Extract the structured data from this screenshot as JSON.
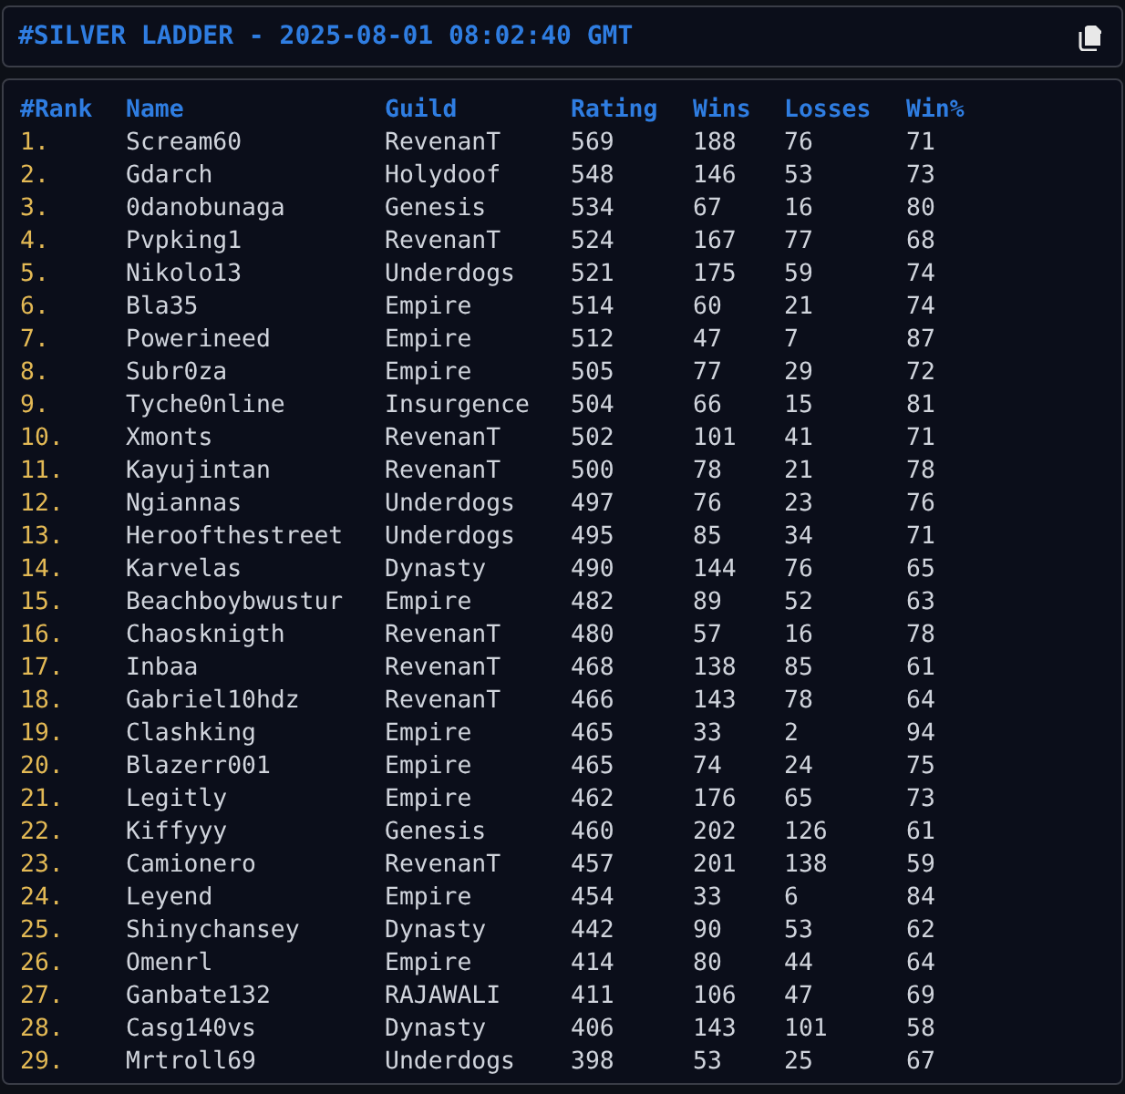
{
  "header": {
    "title": "#SILVER LADDER - 2025-08-01 08:02:40 GMT"
  },
  "table": {
    "columns": [
      "#Rank",
      "Name",
      "Guild",
      "Rating",
      "Wins",
      "Losses",
      "Win%"
    ],
    "rows": [
      [
        "1.",
        "Scream60",
        "RevenanT",
        "569",
        "188",
        "76",
        "71"
      ],
      [
        "2.",
        "Gdarch",
        "Holydoof",
        "548",
        "146",
        "53",
        "73"
      ],
      [
        "3.",
        "0danobunaga",
        "Genesis",
        "534",
        "67",
        "16",
        "80"
      ],
      [
        "4.",
        "Pvpking1",
        "RevenanT",
        "524",
        "167",
        "77",
        "68"
      ],
      [
        "5.",
        "Nikolo13",
        "Underdogs",
        "521",
        "175",
        "59",
        "74"
      ],
      [
        "6.",
        "Bla35",
        "Empire",
        "514",
        "60",
        "21",
        "74"
      ],
      [
        "7.",
        "Powerineed",
        "Empire",
        "512",
        "47",
        "7",
        "87"
      ],
      [
        "8.",
        "Subr0za",
        "Empire",
        "505",
        "77",
        "29",
        "72"
      ],
      [
        "9.",
        "Tyche0nline",
        "Insurgence",
        "504",
        "66",
        "15",
        "81"
      ],
      [
        "10.",
        "Xmonts",
        "RevenanT",
        "502",
        "101",
        "41",
        "71"
      ],
      [
        "11.",
        "Kayujintan",
        "RevenanT",
        "500",
        "78",
        "21",
        "78"
      ],
      [
        "12.",
        "Ngiannas",
        "Underdogs",
        "497",
        "76",
        "23",
        "76"
      ],
      [
        "13.",
        "Heroofthestreet",
        "Underdogs",
        "495",
        "85",
        "34",
        "71"
      ],
      [
        "14.",
        "Karvelas",
        "Dynasty",
        "490",
        "144",
        "76",
        "65"
      ],
      [
        "15.",
        "Beachboybwustur",
        "Empire",
        "482",
        "89",
        "52",
        "63"
      ],
      [
        "16.",
        "Chaosknigth",
        "RevenanT",
        "480",
        "57",
        "16",
        "78"
      ],
      [
        "17.",
        "Inbaa",
        "RevenanT",
        "468",
        "138",
        "85",
        "61"
      ],
      [
        "18.",
        "Gabriel10hdz",
        "RevenanT",
        "466",
        "143",
        "78",
        "64"
      ],
      [
        "19.",
        "Clashking",
        "Empire",
        "465",
        "33",
        "2",
        "94"
      ],
      [
        "20.",
        "Blazerr001",
        "Empire",
        "465",
        "74",
        "24",
        "75"
      ],
      [
        "21.",
        "Legitly",
        "Empire",
        "462",
        "176",
        "65",
        "73"
      ],
      [
        "22.",
        "Kiffyyy",
        "Genesis",
        "460",
        "202",
        "126",
        "61"
      ],
      [
        "23.",
        "Camionero",
        "RevenanT",
        "457",
        "201",
        "138",
        "59"
      ],
      [
        "24.",
        "Leyend",
        "Empire",
        "454",
        "33",
        "6",
        "84"
      ],
      [
        "25.",
        "Shinychansey",
        "Dynasty",
        "442",
        "90",
        "53",
        "62"
      ],
      [
        "26.",
        "Omenrl",
        "Empire",
        "414",
        "80",
        "44",
        "64"
      ],
      [
        "27.",
        "Ganbate132",
        "RAJAWALI",
        "411",
        "106",
        "47",
        "69"
      ],
      [
        "28.",
        "Casg140vs",
        "Dynasty",
        "406",
        "143",
        "101",
        "58"
      ],
      [
        "29.",
        "Mrtroll69",
        "Underdogs",
        "398",
        "53",
        "25",
        "67"
      ]
    ]
  }
}
